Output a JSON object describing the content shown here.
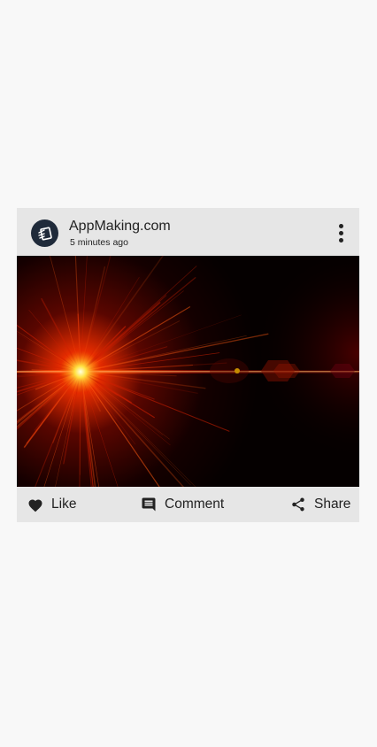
{
  "post": {
    "author": "AppMaking.com",
    "time": "5 minutes ago",
    "avatar_icon": "app-logo-icon",
    "menu_icon": "more-vert-icon",
    "image_description_icon": "lens-flare-image"
  },
  "actions": {
    "like_label": "Like",
    "comment_label": "Comment",
    "share_label": "Share"
  },
  "colors": {
    "card_bg": "#e6e6e6",
    "page_bg": "#f8f8f8",
    "avatar_bg": "#1f2a3a",
    "text": "#222222"
  }
}
